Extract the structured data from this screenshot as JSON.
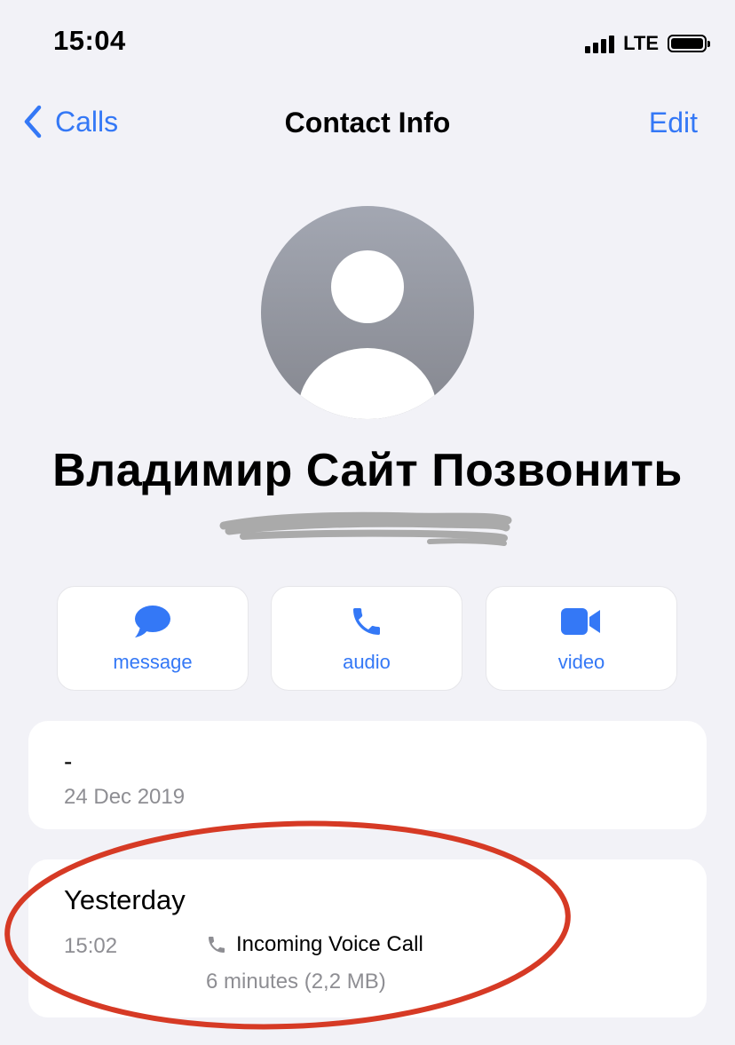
{
  "status_bar": {
    "time": "15:04",
    "network": "LTE",
    "icons": [
      "signal-icon",
      "battery-icon"
    ]
  },
  "nav": {
    "back_label": "Calls",
    "title": "Contact Info",
    "edit_label": "Edit",
    "back_icon": "chevron-left-icon"
  },
  "contact": {
    "name": "Владимир Сайт Позвонить",
    "avatar_icon": "person-placeholder-icon"
  },
  "actions": [
    {
      "label": "message",
      "icon": "message-bubble-icon"
    },
    {
      "label": "audio",
      "icon": "phone-icon"
    },
    {
      "label": "video",
      "icon": "video-camera-icon"
    }
  ],
  "info_card": {
    "value": "-",
    "date": "24 Dec 2019"
  },
  "call_history": {
    "day": "Yesterday",
    "time": "15:02",
    "type": "Incoming Voice Call",
    "type_icon": "phone-small-icon",
    "duration": "6 minutes (2,2 MB)"
  },
  "colors": {
    "accent": "#3478f6",
    "background": "#f2f2f7",
    "secondary_text": "#8e8e93",
    "annotation": "#d63a25"
  }
}
